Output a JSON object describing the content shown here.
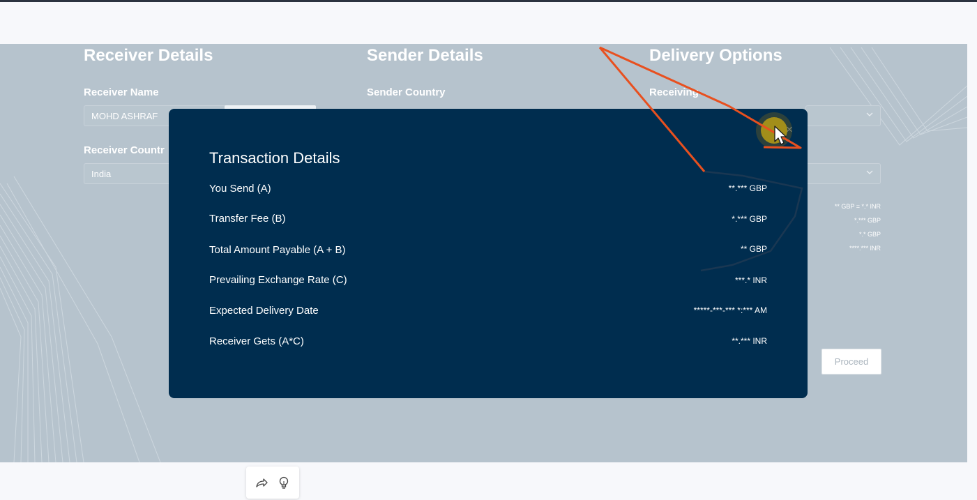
{
  "columns": {
    "receiver_title": "Receiver Details",
    "sender_title": "Sender Details",
    "delivery_title": "Delivery Options"
  },
  "receiver": {
    "name_label": "Receiver Name",
    "name_value": "MOHD ASHRAF",
    "country_label": "Receiver Countr",
    "country_value": "India"
  },
  "sender": {
    "country_label": "Sender Country"
  },
  "delivery": {
    "receiving_label": "Receiving"
  },
  "side_values": [
    "** GBP = *.* INR",
    "*.*** GBP",
    "*.* GBP",
    "****.*** INR"
  ],
  "proceed_label": "Proceed",
  "modal": {
    "title": "Transaction Details",
    "close_glyph": "×",
    "rows": [
      {
        "label": "You Send (A)",
        "value": "**.*** GBP"
      },
      {
        "label": "Transfer Fee (B)",
        "value": "*.*** GBP"
      },
      {
        "label": "Total Amount Payable (A + B)",
        "value": "** GBP"
      },
      {
        "label": "Prevailing Exchange Rate (C)",
        "value": "***.* INR"
      },
      {
        "label": "Expected Delivery Date",
        "value": "*****-***-*** *:*** AM"
      },
      {
        "label": "Receiver Gets (A*C)",
        "value": "**.*** INR"
      }
    ]
  },
  "icons": {
    "share": "share-icon",
    "bulb": "lightbulb-icon",
    "cursor": "cursor-icon"
  },
  "colors": {
    "modal_bg": "#002d4f",
    "page_bg": "#b6c3cd",
    "annotation": "#e8501f",
    "cursor_highlight": "#c9a80f"
  }
}
